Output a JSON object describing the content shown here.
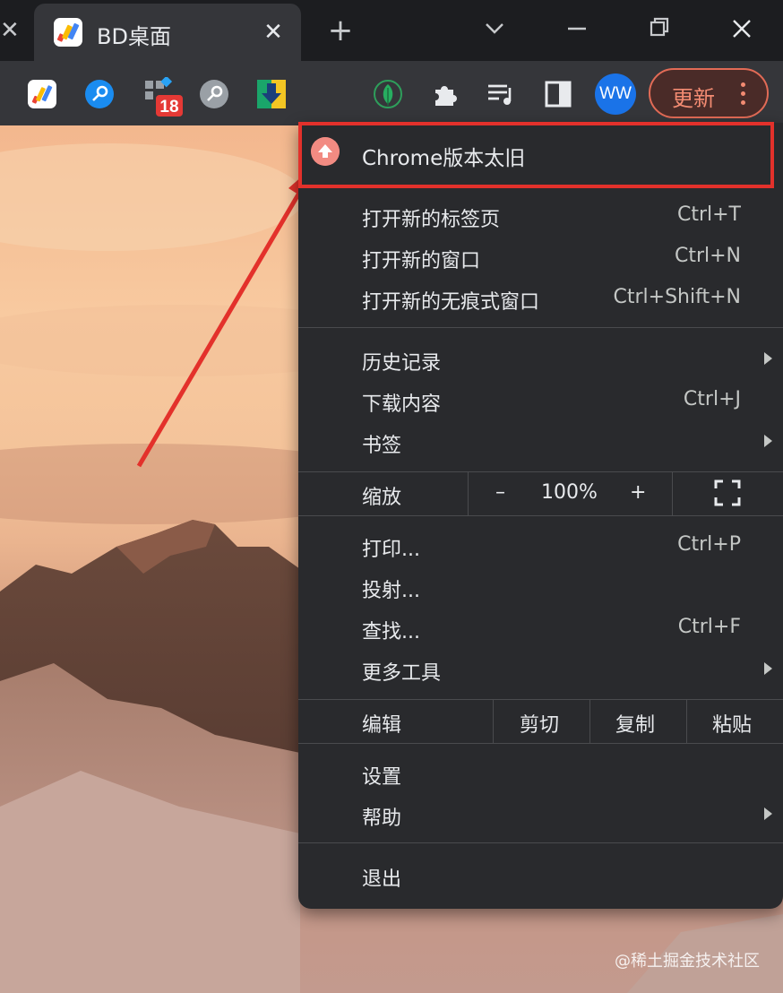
{
  "tabs": {
    "active_title": "BD桌面",
    "new_tab_glyph": "+",
    "close_glyph": "✕"
  },
  "toolbar": {
    "extensions": [
      "multicolor-logo-icon",
      "key-blue-icon",
      "grid-badge-icon",
      "key-gray-icon",
      "download-arrow-icon",
      "leaf-icon",
      "puzzle-icon",
      "playlist-icon",
      "sidepanel-icon"
    ],
    "badge_count": "18",
    "profile_initials": "WW",
    "update_label": "更新"
  },
  "menu": {
    "update_notice": "Chrome版本太旧",
    "group1": [
      {
        "label": "打开新的标签页",
        "shortcut": "Ctrl+T"
      },
      {
        "label": "打开新的窗口",
        "shortcut": "Ctrl+N"
      },
      {
        "label": "打开新的无痕式窗口",
        "shortcut": "Ctrl+Shift+N"
      }
    ],
    "group2": [
      {
        "label": "历史记录",
        "submenu": true
      },
      {
        "label": "下载内容",
        "shortcut": "Ctrl+J"
      },
      {
        "label": "书签",
        "submenu": true
      }
    ],
    "zoom": {
      "label": "缩放",
      "minus": "–",
      "value": "100%",
      "plus": "+"
    },
    "group3": [
      {
        "label": "打印...",
        "shortcut": "Ctrl+P"
      },
      {
        "label": "投射..."
      },
      {
        "label": "查找...",
        "shortcut": "Ctrl+F"
      },
      {
        "label": "更多工具",
        "submenu": true
      }
    ],
    "edit": {
      "label": "编辑",
      "cut": "剪切",
      "copy": "复制",
      "paste": "粘贴"
    },
    "group4": [
      {
        "label": "设置"
      },
      {
        "label": "帮助",
        "submenu": true
      }
    ],
    "exit": "退出"
  },
  "annotation": {
    "highlight_color": "#e3312b"
  },
  "watermark": "@稀土掘金技术社区",
  "colors": {
    "accent_update": "#f28b72",
    "menu_bg": "#292a2d",
    "toolbar_bg": "#35363a"
  }
}
